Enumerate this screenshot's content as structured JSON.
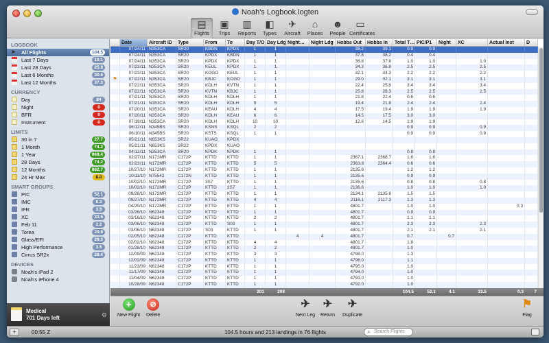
{
  "window": {
    "title": "Noah's Logbook.logten"
  },
  "toolbar": [
    {
      "label": "Flights",
      "icon": "flights-icon",
      "glyph": "▤",
      "active": true
    },
    {
      "label": "Trips",
      "icon": "trips-icon",
      "glyph": "▣",
      "active": false
    },
    {
      "label": "Reports",
      "icon": "reports-icon",
      "glyph": "▥",
      "active": false
    },
    {
      "label": "Types",
      "icon": "types-icon",
      "glyph": "◧",
      "active": false
    },
    {
      "label": "Aircraft",
      "icon": "aircraft-icon",
      "glyph": "✈",
      "active": false
    },
    {
      "label": "Places",
      "icon": "places-icon",
      "glyph": "⌂",
      "active": false
    },
    {
      "label": "People",
      "icon": "people-icon",
      "glyph": "☻",
      "active": false
    },
    {
      "label": "Certificates",
      "icon": "certificates-icon",
      "glyph": "▭",
      "active": false
    }
  ],
  "sidebar": {
    "sections": [
      {
        "header": "LOGBOOK",
        "items": [
          {
            "label": "All Flights",
            "badge": "104.5",
            "icon": "tri",
            "selected": true
          },
          {
            "label": "Last 7 Days",
            "badge": "10.1",
            "icon": "cal"
          },
          {
            "label": "Last 28 Days",
            "badge": "25.8",
            "icon": "cal"
          },
          {
            "label": "Last 6 Months",
            "badge": "30.6",
            "icon": "cal"
          },
          {
            "label": "Last 12 Months",
            "badge": "37.3",
            "icon": "cal"
          }
        ]
      },
      {
        "header": "CURRENCY",
        "items": [
          {
            "label": "Day",
            "badge": "84",
            "icon": "note"
          },
          {
            "label": "Night",
            "badge": "0",
            "icon": "note",
            "badge_color": "red"
          },
          {
            "label": "BFR",
            "badge": "0",
            "icon": "note",
            "badge_color": "red"
          },
          {
            "label": "Instrument",
            "badge": "0",
            "icon": "note",
            "badge_color": "red"
          }
        ]
      },
      {
        "header": "LIMITS",
        "items": [
          {
            "label": "30 in 7",
            "badge": "27.7",
            "icon": "fold",
            "badge_color": "green"
          },
          {
            "label": "1 Month",
            "badge": "74.2",
            "icon": "fold",
            "badge_color": "green"
          },
          {
            "label": "1 Year",
            "badge": "969.4",
            "icon": "fold",
            "badge_color": "green"
          },
          {
            "label": "28 Days",
            "badge": "74.2",
            "icon": "fold",
            "badge_color": "green"
          },
          {
            "label": "12 Months",
            "badge": "862.7",
            "icon": "fold",
            "badge_color": "green"
          },
          {
            "label": "24 Hr Max",
            "badge": "8.0",
            "icon": "fold",
            "badge_color": "yellow"
          }
        ]
      },
      {
        "header": "SMART GROUPS",
        "items": [
          {
            "label": "PIC",
            "badge": "52.1",
            "icon": "grp"
          },
          {
            "label": "IMC",
            "badge": "0.3",
            "icon": "grp"
          },
          {
            "label": "IFR",
            "badge": "3.9",
            "icon": "grp"
          },
          {
            "label": "XC",
            "badge": "33.5",
            "icon": "grp"
          },
          {
            "label": "Feb 11",
            "badge": "2.2",
            "icon": "grp"
          },
          {
            "label": "Torea",
            "badge": "20.8",
            "icon": "grp"
          },
          {
            "label": "Glass/EFI",
            "badge": "29.3",
            "icon": "grp"
          },
          {
            "label": "High Performance",
            "badge": "3.5",
            "icon": "grp"
          },
          {
            "label": "Cirrus SR2x",
            "badge": "28.4",
            "icon": "grp"
          }
        ]
      },
      {
        "header": "DEVICES",
        "items": [
          {
            "label": "Noah's iPad 2",
            "badge": "",
            "icon": "dev"
          },
          {
            "label": "Noah's iPhone 4",
            "badge": "",
            "icon": "dev"
          }
        ]
      }
    ],
    "expiration": {
      "line1": "Medical",
      "line2": "701 Days left"
    }
  },
  "table": {
    "columns": [
      "",
      "Date",
      "Aircraft ID",
      "Type",
      "From",
      "To",
      "Day T/O",
      "Day Ldg",
      "Night…",
      "Night Ldg",
      "Hobbs Out",
      "Hobbs In",
      "Total T…",
      "PIC/P1",
      "Night",
      "XC",
      "Actual Inst",
      "D"
    ],
    "rows": [
      [
        "",
        "07/24/11",
        "N353CA",
        "SR20",
        "KBDN",
        "KPDX",
        "1",
        "1",
        "",
        "",
        "38.2",
        "39.1",
        "0.9",
        "0.9",
        "",
        "",
        "",
        ""
      ],
      [
        "",
        "07/24/11",
        "N353CA",
        "SR20",
        "KPDX",
        "KBDN",
        "1",
        "1",
        "",
        "",
        "37.8",
        "38.2",
        "0.4",
        "0.4",
        "",
        "",
        "",
        ""
      ],
      [
        "",
        "07/24/11",
        "N353CA",
        "SR20",
        "KPDX",
        "KPDX",
        "1",
        "1",
        "",
        "",
        "36.8",
        "37.8",
        "1.0",
        "1.0",
        "",
        "1.0",
        "",
        ""
      ],
      [
        "",
        "07/23/11",
        "N353CA",
        "SR20",
        "KEUL",
        "KPDX",
        "1",
        "1",
        "",
        "",
        "34.3",
        "36.8",
        "2.5",
        "2.5",
        "",
        "2.5",
        "",
        ""
      ],
      [
        "",
        "07/23/11",
        "N353CA",
        "SR20",
        "KOGO",
        "KEUL",
        "1",
        "1",
        "",
        "",
        "32.1",
        "34.3",
        "2.2",
        "2.2",
        "",
        "2.2",
        "",
        ""
      ],
      [
        "⚑",
        "07/22/11",
        "N353CA",
        "SR20",
        "KBJC",
        "KOGD",
        "1",
        "1",
        "",
        "",
        "29.0",
        "32.1",
        "3.1",
        "3.1",
        "",
        "3.1",
        "",
        ""
      ],
      [
        "",
        "07/22/11",
        "N353CA",
        "SR20",
        "KDLH",
        "KVTN",
        "1",
        "1",
        "",
        "",
        "22.4",
        "25.8",
        "3.4",
        "3.4",
        "",
        "3.4",
        "",
        ""
      ],
      [
        "",
        "07/22/11",
        "N353CA",
        "SR20",
        "KVTN",
        "KBJC",
        "1",
        "1",
        "",
        "",
        "25.8",
        "28.3",
        "2.5",
        "2.5",
        "",
        "2.5",
        "",
        ""
      ],
      [
        "",
        "07/21/11",
        "N353CA",
        "SR20",
        "KDLH",
        "KDLH",
        "1",
        "1",
        "",
        "",
        "21.8",
        "22.4",
        "0.6",
        "0.6",
        "",
        "",
        "",
        ""
      ],
      [
        "",
        "07/21/11",
        "N353CA",
        "SR20",
        "KDLH",
        "KDLH",
        "5",
        "5",
        "",
        "",
        "19.4",
        "21.8",
        "2.4",
        "2.4",
        "",
        "2.4",
        "",
        ""
      ],
      [
        "",
        "07/20/11",
        "N353CA",
        "SR20",
        "KEAU",
        "KDLH",
        "4",
        "4",
        "",
        "",
        "17.5",
        "19.4",
        "1.9",
        "1.9",
        "",
        "1.9",
        "",
        ""
      ],
      [
        "",
        "07/20/11",
        "N353CA",
        "SR20",
        "KDLH",
        "KEAU",
        "6",
        "6",
        "",
        "",
        "14.5",
        "17.5",
        "3.0",
        "3.0",
        "",
        "",
        "",
        ""
      ],
      [
        "",
        "07/19/11",
        "N353CA",
        "SR20",
        "KDLH",
        "KDLH",
        "10",
        "10",
        "",
        "",
        "12.6",
        "14.5",
        "1.9",
        "1.9",
        "",
        "",
        "",
        ""
      ],
      [
        "",
        "06/12/11",
        "N345BS",
        "SR20",
        "KSNS",
        "KSQL",
        "2",
        "2",
        "",
        "",
        "",
        "",
        "0.9",
        "0.9",
        "",
        "0.9",
        "",
        ""
      ],
      [
        "",
        "06/10/11",
        "N345BS",
        "SR20",
        "KSTS",
        "KSQL",
        "1",
        "1",
        "",
        "",
        "",
        "",
        "0.9",
        "0.9",
        "",
        "0.9",
        "",
        ""
      ],
      [
        "",
        "05/21/11",
        "N653KS",
        "SR22",
        "KUAO",
        "KPDX",
        "",
        "",
        "",
        "",
        "",
        "",
        "",
        "",
        "",
        "",
        "",
        ""
      ],
      [
        "",
        "05/21/11",
        "N653KS",
        "SR22",
        "KPDX",
        "KUAO",
        "",
        "",
        "",
        "",
        "",
        "",
        "",
        "",
        "",
        "",
        "",
        ""
      ],
      [
        "",
        "04/12/11",
        "N353CA",
        "SR20",
        "KPDK",
        "KPDK",
        "1",
        "1",
        "",
        "",
        "",
        "",
        "0.8",
        "0.8",
        "",
        "",
        "",
        ""
      ],
      [
        "",
        "02/27/11",
        "N172MR",
        "C172P",
        "KTTD",
        "KTTD",
        "1",
        "1",
        "",
        "",
        "2367.1",
        "2368.7",
        "1.6",
        "1.6",
        "",
        "",
        "",
        ""
      ],
      [
        "",
        "02/23/11",
        "N172MR",
        "C172P",
        "KTTD",
        "KTTD",
        "5",
        "5",
        "",
        "",
        "2363.8",
        "2364.4",
        "0.6",
        "0.6",
        "",
        "",
        "",
        ""
      ],
      [
        "",
        "10/27/10",
        "N172MR",
        "C172P",
        "KTTD",
        "KTTD",
        "1",
        "1",
        "",
        "",
        "2135.6",
        "",
        "1.2",
        "1.2",
        "",
        "",
        "",
        ""
      ],
      [
        "",
        "10/11/10",
        "N75542",
        "C172N",
        "KTTD",
        "KTTD",
        "1",
        "1",
        "",
        "",
        "2135.6",
        "",
        "0.9",
        "0.9",
        "",
        "",
        "",
        ""
      ],
      [
        "",
        "10/02/10",
        "N172MR",
        "C172P",
        "3S7",
        "KTTD",
        "1",
        "1",
        "",
        "",
        "2135.6",
        "",
        "0.8",
        "0.8",
        "",
        "0.8",
        "",
        ""
      ],
      [
        "",
        "10/02/10",
        "N172MR",
        "C172P",
        "KTTD",
        "3S7",
        "1",
        "1",
        "",
        "",
        "2136.6",
        "",
        "1.0",
        "1.0",
        "",
        "1.0",
        "",
        ""
      ],
      [
        "",
        "09/28/10",
        "N172MR",
        "C172P",
        "KTTD",
        "KTTD",
        "1",
        "1",
        "",
        "",
        "2134.1",
        "2135.6",
        "1.5",
        "1.5",
        "",
        "",
        "",
        ""
      ],
      [
        "",
        "09/27/10",
        "N172MR",
        "C172P",
        "KTTD",
        "KTTD",
        "4",
        "4",
        "",
        "",
        "2116.1",
        "2117.3",
        "1.3",
        "1.3",
        "",
        "",
        "",
        ""
      ],
      [
        "",
        "04/20/10",
        "N172MR",
        "C172P",
        "KTTD",
        "KTTD",
        "1",
        "1",
        "",
        "",
        "4801.7",
        "",
        "1.0",
        "1.0",
        "",
        "",
        "0.3",
        ""
      ],
      [
        "",
        "03/26/10",
        "N62348",
        "C172P",
        "KTTD",
        "KTTD",
        "1",
        "1",
        "",
        "",
        "4801.7",
        "",
        "0.9",
        "0.9",
        "",
        "",
        "",
        ""
      ],
      [
        "",
        "03/16/10",
        "N62348",
        "C172P",
        "KTTD",
        "KTTD",
        "2",
        "2",
        "",
        "",
        "4801.7",
        "",
        "1.1",
        "1.1",
        "",
        "",
        "",
        ""
      ],
      [
        "",
        "03/06/10",
        "N62348",
        "C172P",
        "KTTD",
        "S03",
        "1",
        "1",
        "",
        "",
        "4801.7",
        "",
        "2.3",
        "2.3",
        "",
        "2.3",
        "",
        ""
      ],
      [
        "",
        "03/06/10",
        "N62348",
        "C172P",
        "S03",
        "KTTD",
        "1",
        "1",
        "",
        "",
        "4801.7",
        "",
        "2.1",
        "2.1",
        "",
        "2.1",
        "",
        ""
      ],
      [
        "",
        "02/05/10",
        "N62348",
        "C172P",
        "KTTD",
        "KTTD",
        "",
        "",
        "4",
        "4",
        "4801.7",
        "",
        "0.7",
        "",
        "0.7",
        "",
        "",
        ""
      ],
      [
        "",
        "02/02/10",
        "N62348",
        "C172P",
        "KTTD",
        "KTTD",
        "4",
        "4",
        "",
        "",
        "4801.7",
        "",
        "1.8",
        "",
        "",
        "",
        "",
        ""
      ],
      [
        "",
        "01/28/10",
        "N62348",
        "C172P",
        "KTTD",
        "KTTD",
        "2",
        "2",
        "",
        "",
        "4801.7",
        "",
        "1.0",
        "",
        "",
        "",
        "",
        ""
      ],
      [
        "",
        "12/09/09",
        "N62348",
        "C172P",
        "KTTD",
        "KTTD",
        "3",
        "3",
        "",
        "",
        "4798.0",
        "",
        "1.3",
        "",
        "",
        "",
        "",
        ""
      ],
      [
        "",
        "12/02/09",
        "N62348",
        "C172P",
        "KTTD",
        "KTTD",
        "1",
        "1",
        "",
        "",
        "4796.0",
        "",
        "1.1",
        "",
        "",
        "",
        "",
        ""
      ],
      [
        "",
        "11/23/09",
        "N62348",
        "C172P",
        "KTTD",
        "KTTD",
        "1",
        "1",
        "",
        "",
        "4795.0",
        "",
        "1.0",
        "",
        "",
        "",
        "",
        ""
      ],
      [
        "",
        "11/17/09",
        "N62348",
        "C172P",
        "KTTD",
        "KTTD",
        "1",
        "1",
        "",
        "",
        "4794.0",
        "",
        "1.0",
        "",
        "",
        "",
        "",
        ""
      ],
      [
        "",
        "11/04/09",
        "N62348",
        "C172P",
        "KTTD",
        "KTTD",
        "1",
        "1",
        "",
        "",
        "4793.0",
        "",
        "1.0",
        "",
        "",
        "",
        "",
        ""
      ],
      [
        "",
        "10/28/09",
        "N62348",
        "C172P",
        "KTTD",
        "KTTD",
        "1",
        "1",
        "",
        "",
        "4792.0",
        "",
        "1.0",
        "",
        "",
        "",
        "",
        ""
      ]
    ],
    "totals": [
      "",
      "",
      "",
      "",
      "",
      "",
      "201",
      "208",
      "",
      "",
      "",
      "",
      "104.5",
      "52.1",
      "4.1",
      "33.5",
      "0.3",
      "7"
    ]
  },
  "actions": {
    "new_flight": "New Flight",
    "delete": "Delete",
    "next_leg": "Next Leg",
    "return": "Return",
    "duplicate": "Duplicate",
    "flag": "Flag"
  },
  "status": {
    "clock": "00:55 Z",
    "summary": "104.5 hours and 213 landings in 76 flights",
    "search_placeholder": "Search Flights"
  },
  "colors": {
    "selection": "#3d6cc2",
    "badge_default": "#7e94b6",
    "badge_red": "#d42a1f",
    "badge_green": "#3d9b23",
    "badge_yellow": "#e0b820"
  }
}
